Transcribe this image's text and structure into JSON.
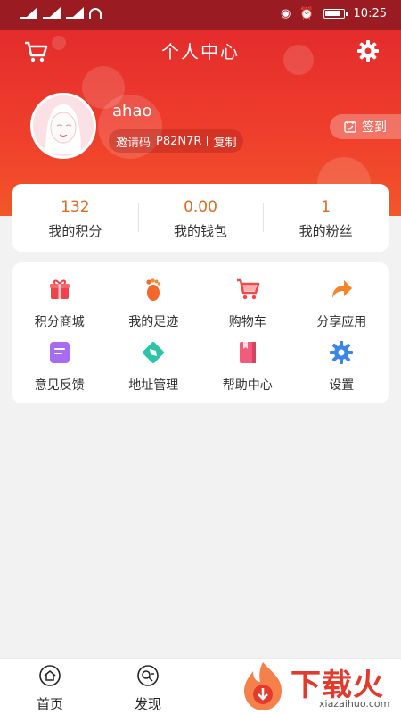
{
  "status_bar": {
    "time": "10:25"
  },
  "header": {
    "title": "个人中心"
  },
  "profile": {
    "username": "ahao",
    "invite_label": "邀请码",
    "invite_code": "P82N7R",
    "copy_label": "复制",
    "signin_label": "签到"
  },
  "stats": [
    {
      "value": "132",
      "label": "我的积分"
    },
    {
      "value": "0.00",
      "label": "我的钱包"
    },
    {
      "value": "1",
      "label": "我的粉丝"
    }
  ],
  "menu": [
    {
      "label": "积分商城",
      "icon": "gift-icon"
    },
    {
      "label": "我的足迹",
      "icon": "footprint-icon"
    },
    {
      "label": "购物车",
      "icon": "cart-icon"
    },
    {
      "label": "分享应用",
      "icon": "share-icon"
    },
    {
      "label": "意见反馈",
      "icon": "feedback-icon"
    },
    {
      "label": "地址管理",
      "icon": "compass-icon"
    },
    {
      "label": "帮助中心",
      "icon": "book-icon"
    },
    {
      "label": "设置",
      "icon": "gear-icon"
    }
  ],
  "tabs": [
    {
      "label": "首页",
      "icon": "home-icon"
    },
    {
      "label": "发现",
      "icon": "discover-icon"
    }
  ],
  "watermark": {
    "title": "下载火",
    "subtitle": "xiazaihuo.com"
  },
  "colors": {
    "primary": "#e42c2c",
    "stat_value": "#e06a1e"
  }
}
